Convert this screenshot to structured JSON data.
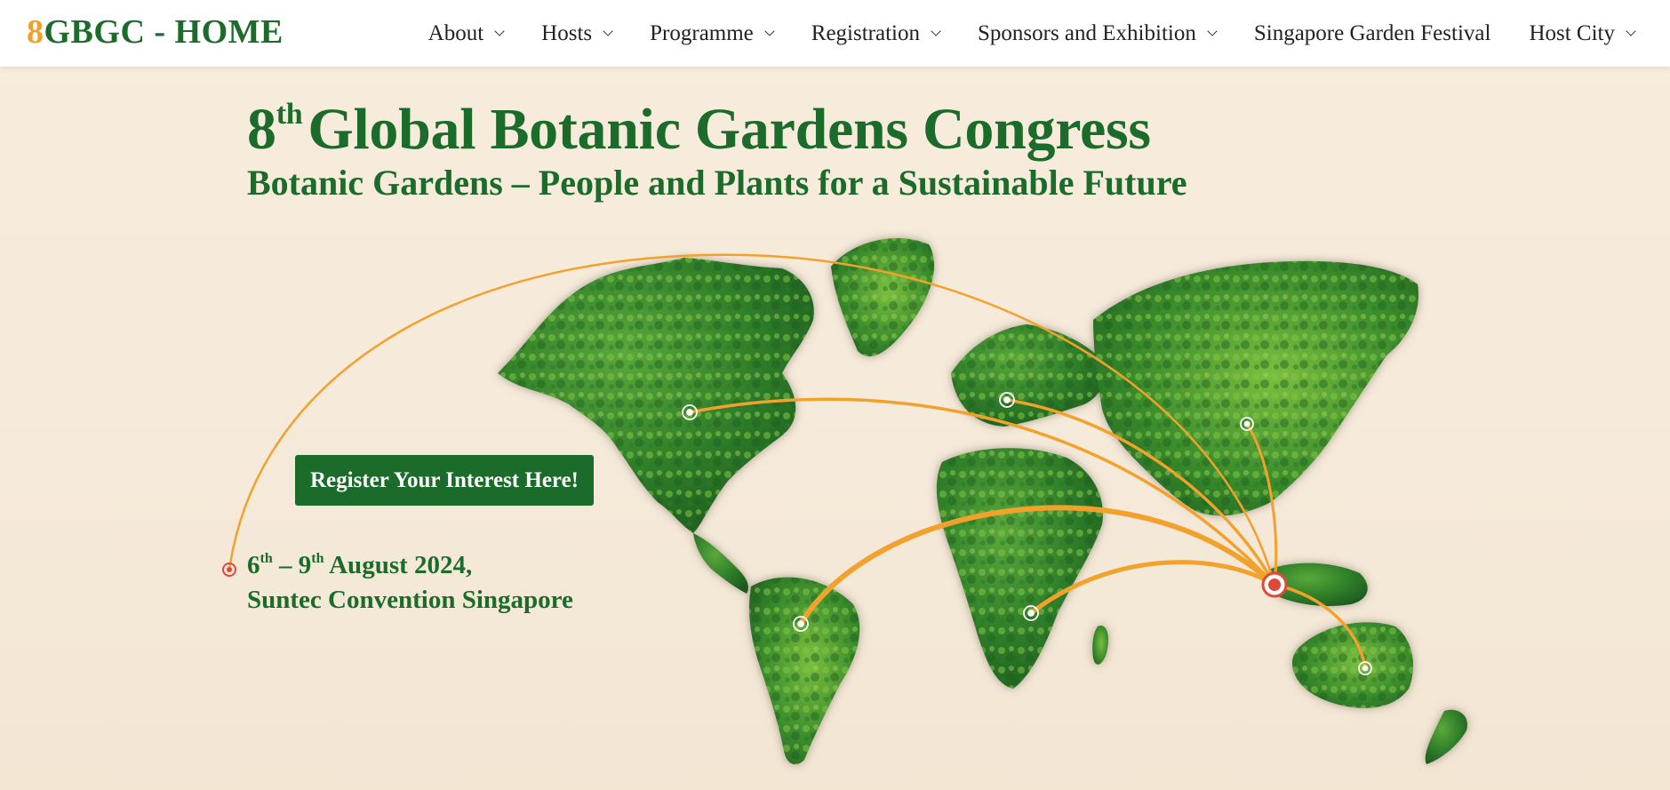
{
  "brand": {
    "number": "8",
    "text": "GBGC - HOME"
  },
  "nav": [
    {
      "label": "About",
      "has_dropdown": true
    },
    {
      "label": "Hosts",
      "has_dropdown": true
    },
    {
      "label": "Programme",
      "has_dropdown": true
    },
    {
      "label": "Registration",
      "has_dropdown": true
    },
    {
      "label": "Sponsors and Exhibition",
      "has_dropdown": true
    },
    {
      "label": "Singapore Garden Festival",
      "has_dropdown": false
    },
    {
      "label": "Host City",
      "has_dropdown": true
    }
  ],
  "hero": {
    "title_number": "8",
    "title_suffix": "th",
    "title_rest": "Global Botanic Gardens Congress",
    "subtitle": "Botanic Gardens – People and Plants for a Sustainable Future",
    "cta_label": "Register Your Interest Here!",
    "date_start_day": "6",
    "date_start_suffix": "th",
    "date_separator": " – ",
    "date_end_day": "9",
    "date_end_suffix": "th",
    "date_rest": " August 2024,",
    "venue": "Suntec Convention Singapore"
  },
  "colors": {
    "brand_green": "#1b6b2a",
    "accent_orange": "#f0a12b",
    "background": "#f7eadb",
    "marker_red": "#e2483a"
  },
  "icons": {
    "dropdown": "chevron-down-icon",
    "location": "location-marker-icon",
    "map": "world-map-illustration"
  }
}
